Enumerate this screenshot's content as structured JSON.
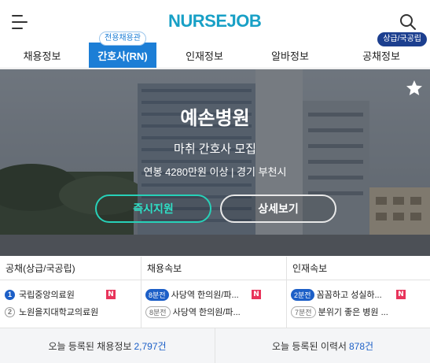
{
  "header": {
    "logo_text": "NURSEJOB",
    "logo_color": "#18a0c6"
  },
  "nav": {
    "tabs": [
      {
        "label": "채용정보"
      },
      {
        "label": "간호사(RN)",
        "badge": "전용채용관",
        "active": true
      },
      {
        "label": "인재정보"
      },
      {
        "label": "알바정보"
      },
      {
        "label": "공채정보",
        "badge": "상급/국공립"
      }
    ]
  },
  "hero": {
    "title": "예손병원",
    "subtitle": "마취 간호사 모집",
    "info": "연봉 4280만원 이상 | 경기 부천시",
    "apply_button": "즉시지원",
    "detail_button": "상세보기",
    "accent_color": "#27d1b8"
  },
  "columns": {
    "public": {
      "title": "공채(상급/국공립)",
      "items": [
        {
          "rank": "1",
          "text": "국립중앙의료원",
          "new": "N"
        },
        {
          "rank": "2",
          "text": "노원을지대학교의료원"
        }
      ]
    },
    "jobs": {
      "title": "채용속보",
      "items": [
        {
          "time": "8분전",
          "text": "사당역 한의원/파...",
          "new": "N"
        },
        {
          "time": "8분전",
          "text": "사당역 한의원/파..."
        }
      ]
    },
    "talent": {
      "title": "인재속보",
      "items": [
        {
          "time": "2분전",
          "text": "꼼꼼하고 성실하...",
          "new": "N"
        },
        {
          "time": "7분전",
          "text": "분위기 좋은 병원 ..."
        }
      ]
    }
  },
  "stats": {
    "jobs_label": "오늘 등록된 채용정보",
    "jobs_count": "2,797건",
    "resumes_label": "오늘 등록된 이력서",
    "resumes_count": "878건"
  },
  "icons": {
    "menu": "menu-icon",
    "search": "search-icon",
    "favorite": "star-icon"
  },
  "colors": {
    "primary": "#1c7ed6",
    "dark_blue": "#1c5fc7",
    "new_badge": "#e8345b"
  }
}
